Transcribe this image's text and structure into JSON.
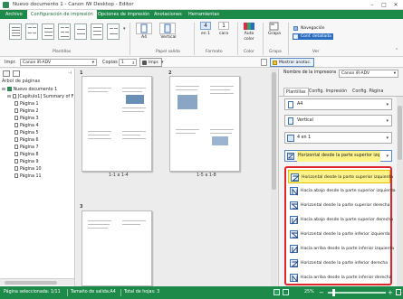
{
  "window": {
    "title": "Nuevo documento 1 - Canon iW Desktop - Editor",
    "controls": [
      "–",
      "□",
      "✕"
    ]
  },
  "ribbon_tabs": [
    "Archivo",
    "Configuración de impresión",
    "Opciones de impresión",
    "Anotaciones",
    "Herramientas"
  ],
  "ribbon": {
    "groups": {
      "plantillas": "Plantillas",
      "papel_salida": "Papel salida",
      "formato": "Formato",
      "color": "Color",
      "grapa": "Grapa",
      "ver": "Ver"
    },
    "paper_size": "A4",
    "orientation": "Vertical",
    "nup_value": "4",
    "nup_label": "en 1",
    "sides_value": "1",
    "sides_label": "cara",
    "color_value": "Auto",
    "color_label": "color",
    "grapa_label": "Grapa",
    "nav_items": [
      "Navegación",
      "Conf. detallada"
    ]
  },
  "printbar": {
    "printer_label": "Impr.",
    "printer_value": "Canon iR-ADV",
    "copies_label": "Copias",
    "copies_value": "1",
    "print_button": "Impr.",
    "show_annot_button": "Mostrar anotac."
  },
  "left_panel": {
    "header": "Árbol de páginas",
    "root": "Nuevo documento 1",
    "chapter": "[Capítulo1] Summary of F",
    "pages": [
      "Página 1",
      "Página 2",
      "Página 3",
      "Página 4",
      "Página 5",
      "Página 6",
      "Página 7",
      "Página 8",
      "Página 9",
      "Página 10",
      "Página 11"
    ]
  },
  "center": {
    "group1_number": "1",
    "group2_number": "2",
    "group3_number": "3",
    "caption1": "1-1 a 1-4",
    "caption2": "1-5 a 1-8"
  },
  "right_panel": {
    "printer_name_label": "Nombre de la impresora",
    "printer_name_value": "Canon iR-ADV",
    "tabs": [
      "Plantillas",
      "Config. Impresión",
      "Config. Página"
    ],
    "paper_size": "A4",
    "orientation": "Vertical",
    "nup": "4 en 1",
    "page_order_selected": "Horizontal desde la parte superior izq",
    "page_order_options": [
      "Horizontal desde la parte superior izquierda",
      "Hacia abajo desde la parte superior izquierda",
      "Horizontal desde la parte superior derecha",
      "Hacia abajo desde la parte superior derecha",
      "Horizontal desde la parte inferior izquierda",
      "Hacia arriba desde la parte inferior izquierda",
      "Horizontal desde la parte inferior derecha",
      "Hacia arriba desde la parte inferior derecha"
    ]
  },
  "status": {
    "pages_selected": "Página seleccionada: 1/11",
    "output_size": "Tamaño de salida:A4",
    "total_sheets": "Total de hojas: 3",
    "zoom": "25%"
  },
  "colors": {
    "brand_green": "#1d8a4a",
    "highlight_red": "#e0262c",
    "selected_yellow": "#fff48a",
    "nav_blue": "#2a6fc2"
  }
}
